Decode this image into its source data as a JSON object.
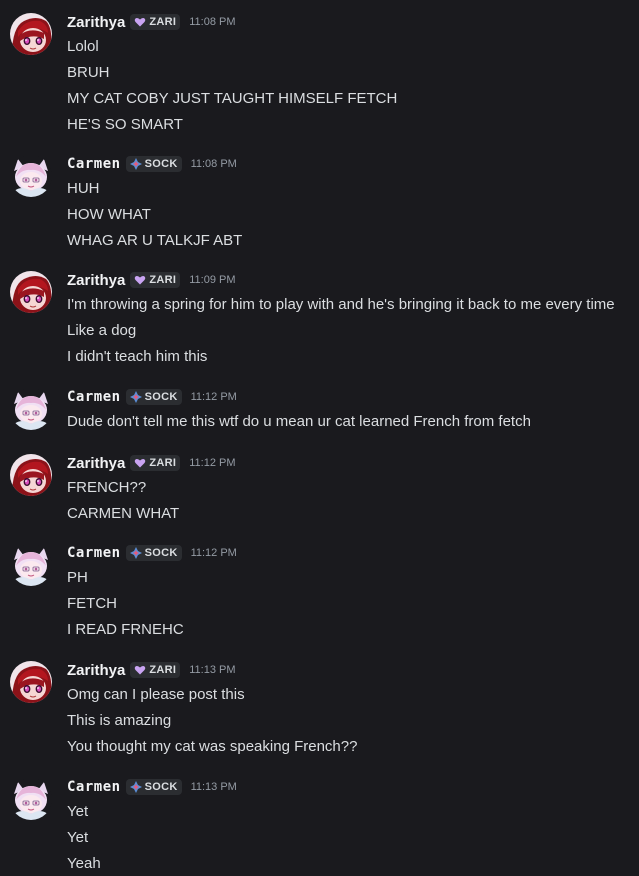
{
  "messages": [
    {
      "user": "Zarithya",
      "tag": "ZARI",
      "time": "11:08 PM",
      "lines": [
        "Lolol",
        "BRUH",
        "MY CAT COBY JUST TAUGHT HIMSELF FETCH",
        "HE'S SO SMART"
      ]
    },
    {
      "user": "Carmen",
      "tag": "SOCK",
      "time": "11:08 PM",
      "lines": [
        "HUH",
        "HOW WHAT",
        "WHAG AR U TALKJF ABT"
      ]
    },
    {
      "user": "Zarithya",
      "tag": "ZARI",
      "time": "11:09 PM",
      "lines": [
        "I'm throwing a spring for him to play with and he's bringing it back to me every time",
        "Like a dog",
        "I didn't teach him this"
      ]
    },
    {
      "user": "Carmen",
      "tag": "SOCK",
      "time": "11:12 PM",
      "lines": [
        "Dude don't tell me this wtf do u mean ur cat learned French from fetch"
      ]
    },
    {
      "user": "Zarithya",
      "tag": "ZARI",
      "time": "11:12 PM",
      "lines": [
        "FRENCH??",
        "CARMEN WHAT"
      ]
    },
    {
      "user": "Carmen",
      "tag": "SOCK",
      "time": "11:12 PM",
      "lines": [
        "PH",
        "FETCH",
        "I READ FRNEHC"
      ]
    },
    {
      "user": "Zarithya",
      "tag": "ZARI",
      "time": "11:13 PM",
      "lines": [
        "Omg can I please post this",
        "This is amazing",
        "You thought my cat was speaking French??"
      ]
    },
    {
      "user": "Carmen",
      "tag": "SOCK",
      "time": "11:13 PM",
      "lines": [
        "Yet",
        "Yet",
        "Yeah"
      ]
    }
  ],
  "colors": {
    "background": "#1a1a1e",
    "username": "#f2f3f5",
    "message_text": "#dbdee1",
    "timestamp": "#949ba4",
    "zari_tag_icon": "#c9a4f2",
    "sock_tag_icon": "#5b8fd8"
  },
  "icons": {
    "zari_tag": "purple-heart-icon",
    "sock_tag": "sparkle-diamond-icon"
  }
}
